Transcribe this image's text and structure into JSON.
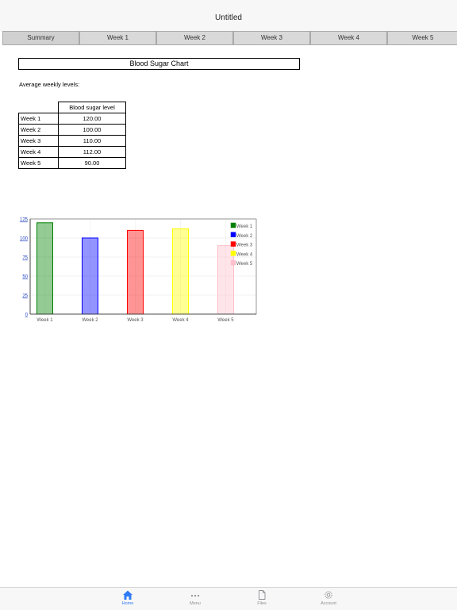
{
  "app": {
    "title": "Untitled"
  },
  "tabs": [
    "Summary",
    "Week 1",
    "Week 2",
    "Week 3",
    "Week 4",
    "Week 5"
  ],
  "sheet": {
    "title": "Blood Sugar Chart",
    "subtitle": "Average weekly levels:",
    "table": {
      "header": "Blood sugar level",
      "rows": [
        {
          "label": "Week 1",
          "value": "120.00"
        },
        {
          "label": "Week 2",
          "value": "100.00"
        },
        {
          "label": "Week 3",
          "value": "110.00"
        },
        {
          "label": "Week 4",
          "value": "112.00"
        },
        {
          "label": "Week 5",
          "value": "90.00"
        }
      ]
    }
  },
  "chart_data": {
    "type": "bar",
    "categories": [
      "Week 1",
      "Week 2",
      "Week 3",
      "Week 4",
      "Week 5"
    ],
    "values": [
      120,
      100,
      110,
      112,
      90
    ],
    "series": [
      {
        "name": "Week 1",
        "value": 120,
        "color": "#008000"
      },
      {
        "name": "Week 2",
        "value": 100,
        "color": "#0000ff"
      },
      {
        "name": "Week 3",
        "value": 110,
        "color": "#ff0000"
      },
      {
        "name": "Week 4",
        "value": 112,
        "color": "#ffff00"
      },
      {
        "name": "Week 5",
        "value": 90,
        "color": "#ffc0cb"
      }
    ],
    "y_ticks": [
      "0",
      "25",
      "50",
      "75",
      "100",
      "125"
    ],
    "ylim": [
      0,
      125
    ],
    "grid": true,
    "legend": "top-right"
  },
  "tabbar": {
    "items": [
      {
        "label": "Home",
        "icon": "home-icon",
        "active": true
      },
      {
        "label": "Menu",
        "icon": "more-icon"
      },
      {
        "label": "Files",
        "icon": "file-icon"
      },
      {
        "label": "Account",
        "icon": "gear-icon"
      }
    ],
    "accent": "#2f7bf5"
  }
}
